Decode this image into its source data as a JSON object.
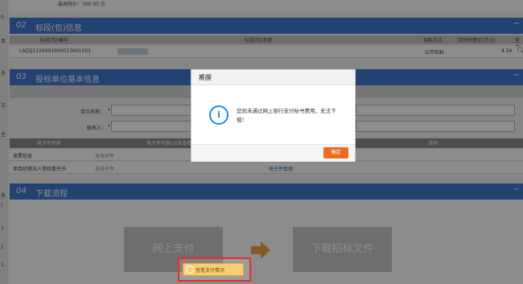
{
  "top": {
    "partial_text": "最高限价：300.00 万"
  },
  "left_strip": [
    "0",
    "目",
    "多",
    "文",
    "主",
    "务",
    "(",
    "1",
    "1",
    "1"
  ],
  "sec2": {
    "num": "02",
    "title": "标段(包)信息",
    "headers": [
      "标段(包)编号",
      "标段(包)名称",
      "招标方式",
      "合同估算价(万元)",
      "查看"
    ],
    "row": {
      "code": "LAZQ1110001000013001001",
      "name": "",
      "method": "公开招标",
      "price": "4.54",
      "action_icon": "search-icon"
    }
  },
  "sec3": {
    "num": "03",
    "title": "投标单位基本信息",
    "company_label": "单位名称：",
    "contact_label": "联系人：",
    "required_mark": "*",
    "file_headers": [
      "电子件名称",
      "电子件列表(点击查看)",
      "说明"
    ],
    "files": [
      {
        "name": "发票信息",
        "status": "无电子件",
        "action": ""
      },
      {
        "name": "项目经理法人授权委托书",
        "status": "无电子件",
        "action": "电子件管理"
      }
    ]
  },
  "sec4": {
    "num": "04",
    "title": "下载流程",
    "step1": "网上支付",
    "step2": "下载招标文件",
    "view_payment": "查看支付情况"
  },
  "dialog": {
    "title": "提醒",
    "close": "×",
    "message": "您尚未通过网上银行支付标书费用，无法下载！",
    "ok": "确定",
    "icon": "info-icon"
  },
  "colors": {
    "header_blue": "#3f79d0",
    "ok_orange": "#f06b22",
    "highlight_red": "#e5302f"
  }
}
